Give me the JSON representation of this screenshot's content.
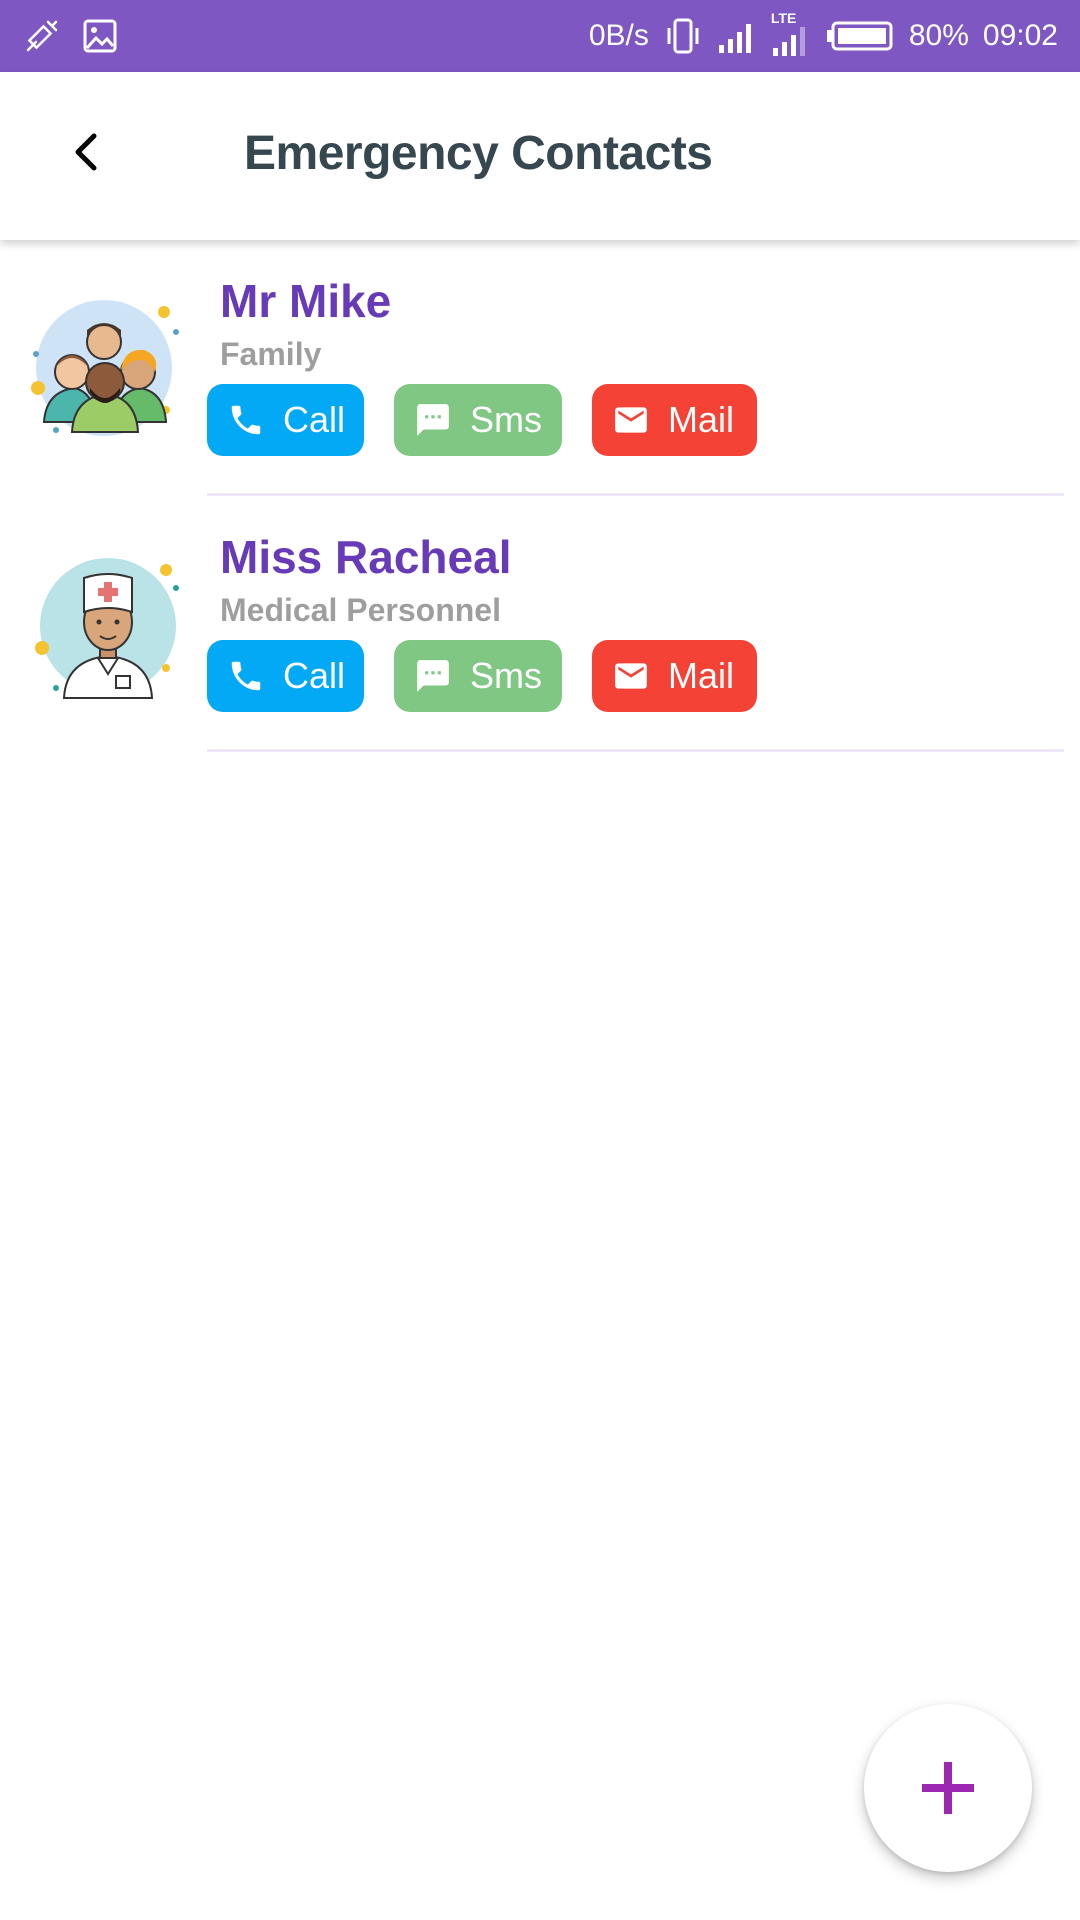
{
  "status_bar": {
    "net_speed": "0B/s",
    "network_type": "LTE",
    "battery": "80%",
    "time": "09:02",
    "icons": [
      "syringe-icon",
      "image-icon",
      "vibrate-icon",
      "signal-icon",
      "lte-signal-icon",
      "battery-icon"
    ]
  },
  "header": {
    "title": "Emergency Contacts",
    "back_icon": "chevron-left-icon"
  },
  "contacts": [
    {
      "name": "Mr Mike",
      "relation": "Family",
      "avatar": "family-group-avatar",
      "actions": {
        "call": "Call",
        "sms": "Sms",
        "mail": "Mail"
      }
    },
    {
      "name": "Miss Racheal",
      "relation": "Medical Personnel",
      "avatar": "doctor-avatar",
      "actions": {
        "call": "Call",
        "sms": "Sms",
        "mail": "Mail"
      }
    }
  ],
  "fab": {
    "icon": "plus-icon"
  },
  "colors": {
    "status_bar": "#7e57c2",
    "title": "#37474f",
    "name": "#673ab7",
    "relation": "#9e9e9e",
    "call": "#03a9f4",
    "sms": "#81c784",
    "mail": "#f44336",
    "fab_plus": "#9c27b0"
  }
}
